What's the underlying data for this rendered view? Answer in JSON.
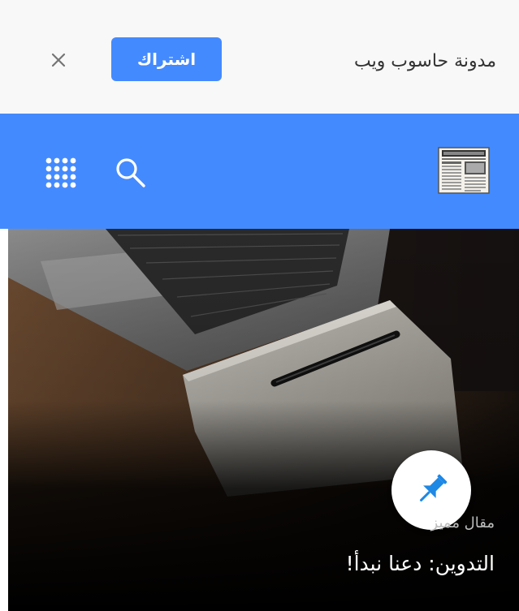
{
  "banner": {
    "title": "مدونة حاسوب ويب",
    "subscribe_label": "اشتراك",
    "close_label": "×"
  },
  "header": {
    "logo_icon": "newspaper-icon",
    "search_icon": "search-icon",
    "apps_icon": "apps-grid-icon"
  },
  "hero": {
    "badge_icon": "pin-icon",
    "featured_label": "مقال مميز",
    "post_title": "التدوين: دعنا نبدأ!"
  },
  "colors": {
    "accent": "#448aff",
    "banner_bg": "#f8f8f8",
    "pin_color": "#1e88e5"
  }
}
